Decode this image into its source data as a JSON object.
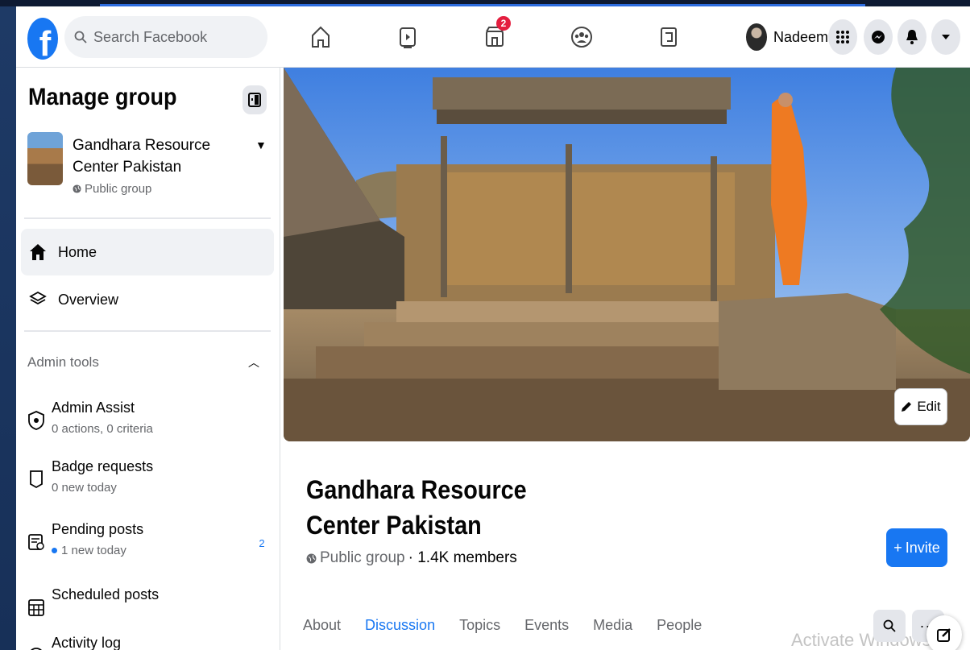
{
  "topbar": {
    "logo_letter": "f",
    "search_placeholder": "Search Facebook",
    "marketplace_badge": "2",
    "user_name": "Nadeem",
    "accent": "#1877f2",
    "icons": [
      "home-icon",
      "watch-icon",
      "marketplace-icon",
      "groups-icon",
      "gaming-icon",
      "menu-grid-icon",
      "messenger-icon",
      "notifications-icon",
      "account-caret-icon"
    ]
  },
  "sidebar": {
    "title": "Manage group",
    "group_name": "Gandhara Resource Center Pakistan",
    "group_privacy": "Public group",
    "nav": [
      {
        "label": "Home"
      },
      {
        "label": "Overview"
      }
    ],
    "admin_tools_heading": "Admin tools",
    "tools": [
      {
        "label": "Admin Assist",
        "sub": "0 actions, 0 criteria"
      },
      {
        "label": "Badge requests",
        "sub": "0 new today"
      },
      {
        "label": "Pending posts",
        "sub": "1 new today",
        "count": "2"
      },
      {
        "label": "Scheduled posts"
      },
      {
        "label": "Activity log"
      }
    ]
  },
  "main": {
    "edit_label": "Edit",
    "group_title": "Gandhara Resource Center Pakistan",
    "privacy": "Public group",
    "members": "· 1.4K members",
    "invite_label": "Invite",
    "tabs": [
      {
        "label": "About"
      },
      {
        "label": "Discussion"
      },
      {
        "label": "Topics"
      },
      {
        "label": "Events"
      },
      {
        "label": "Media"
      },
      {
        "label": "People"
      }
    ],
    "more_label": "···"
  },
  "watermark": "Activate Windows"
}
